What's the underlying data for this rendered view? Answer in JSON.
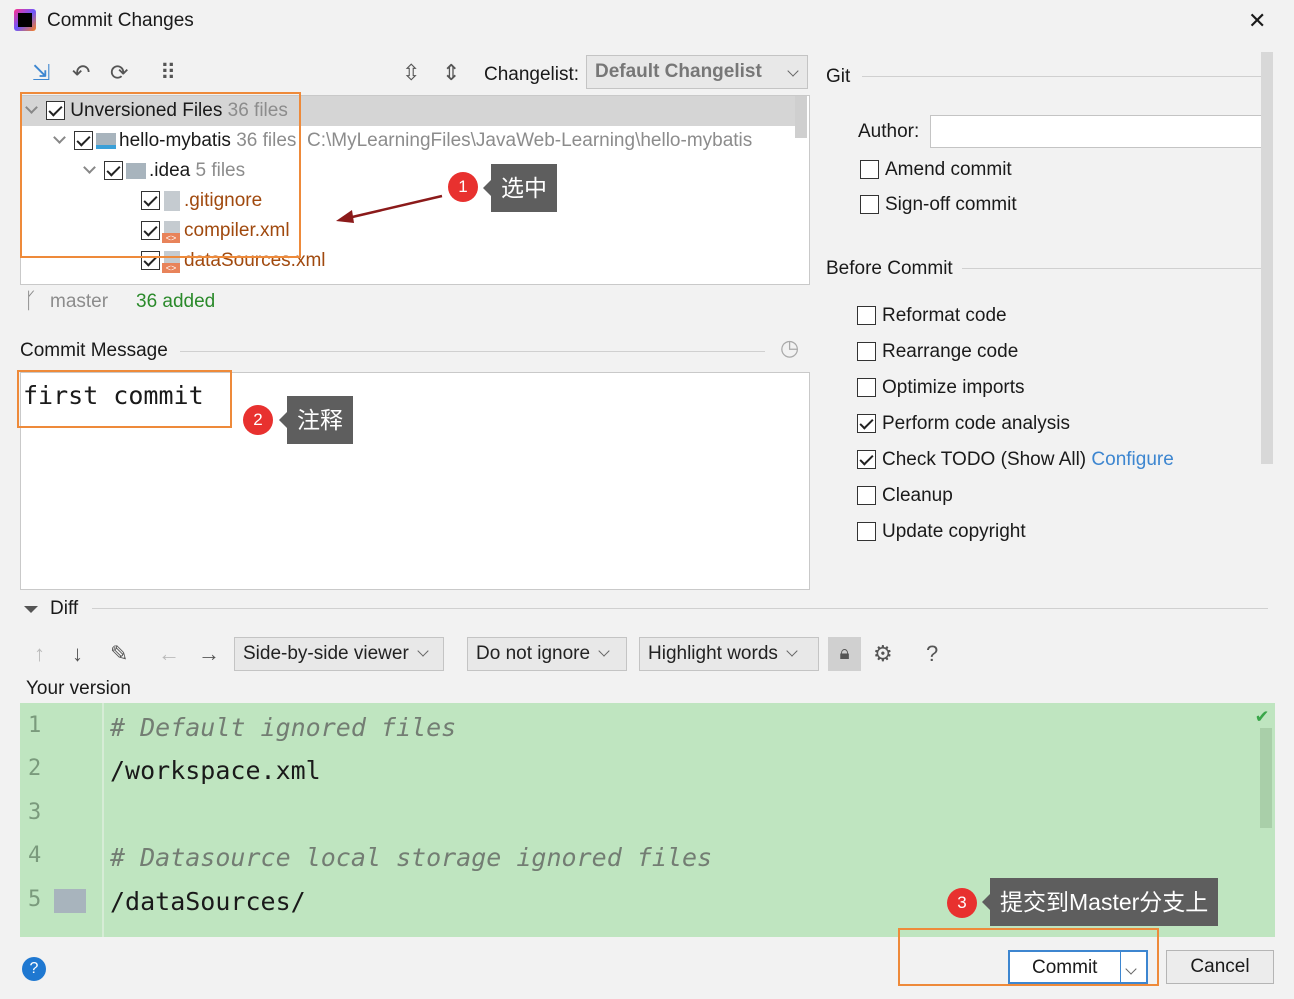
{
  "window": {
    "title": "Commit Changes",
    "close": "✕"
  },
  "toolbar": {
    "changelist_label": "Changelist:",
    "changelist_value": "Default Changelist"
  },
  "tree": {
    "root": {
      "label": "Unversioned Files",
      "count": "36 files",
      "checked": true
    },
    "project": {
      "label": "hello-mybatis",
      "count": "36 files",
      "path": "C:\\MyLearningFiles\\JavaWeb-Learning\\hello-mybatis",
      "checked": true
    },
    "folder": {
      "label": ".idea",
      "count": "5 files",
      "checked": true
    },
    "files": [
      {
        "label": ".gitignore",
        "checked": true
      },
      {
        "label": "compiler.xml",
        "checked": true
      },
      {
        "label": "dataSources.xml",
        "checked": true
      }
    ]
  },
  "status": {
    "branch": "master",
    "added": "36 added"
  },
  "commit_message": {
    "label": "Commit Message",
    "value": "first commit"
  },
  "git": {
    "title": "Git",
    "author_label": "Author:",
    "author_value": "",
    "amend": "Amend commit",
    "signoff": "Sign-off commit"
  },
  "before_commit": {
    "title": "Before Commit",
    "options": [
      {
        "label": "Reformat code",
        "checked": false
      },
      {
        "label": "Rearrange code",
        "checked": false
      },
      {
        "label": "Optimize imports",
        "checked": false
      },
      {
        "label": "Perform code analysis",
        "checked": true
      },
      {
        "label": "Check TODO (Show All)",
        "checked": true
      },
      {
        "label": "Cleanup",
        "checked": false
      },
      {
        "label": "Update copyright",
        "checked": false
      }
    ],
    "configure_link": "Configure"
  },
  "diff": {
    "title": "Diff",
    "viewer": "Side-by-side viewer",
    "ignore": "Do not ignore",
    "highlight": "Highlight words",
    "help": "?",
    "your_version": "Your version",
    "lines": [
      {
        "n": "1",
        "text": "# Default ignored files",
        "comment": true
      },
      {
        "n": "2",
        "text": "/workspace.xml",
        "comment": false
      },
      {
        "n": "3",
        "text": "",
        "comment": false
      },
      {
        "n": "4",
        "text": "# Datasource local storage ignored files",
        "comment": true
      },
      {
        "n": "5",
        "text": "/dataSources/",
        "comment": false
      }
    ]
  },
  "buttons": {
    "commit": "Commit",
    "cancel": "Cancel",
    "help": "?"
  },
  "annotations": [
    {
      "n": "1",
      "text": "选中"
    },
    {
      "n": "2",
      "text": "注释"
    },
    {
      "n": "3",
      "text": "提交到Master分支上"
    }
  ],
  "colors": {
    "accent": "#3d86d0",
    "added": "#2b8a2b",
    "diff_bg": "#bfe5c0",
    "annotation_border": "#ee8a3a",
    "badge": "#e8312f"
  }
}
